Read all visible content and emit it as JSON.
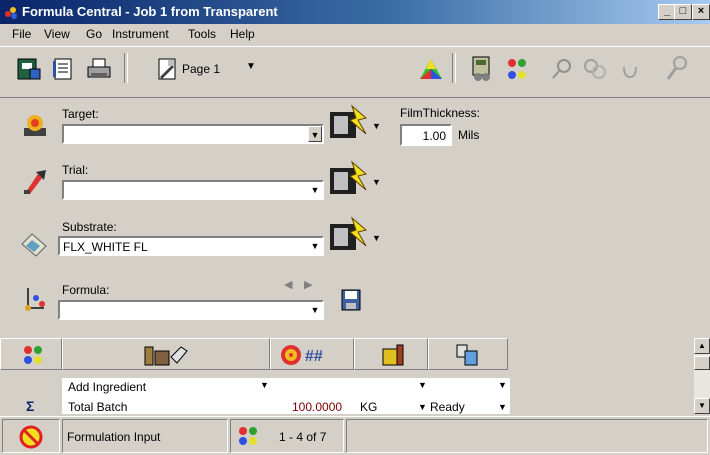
{
  "window": {
    "title": "Formula Central - Job 1 from Transparent",
    "controls": [
      "_",
      "□",
      "×"
    ]
  },
  "menu": [
    "File",
    "View",
    "Go",
    "Instrument",
    "Tools",
    "Help"
  ],
  "toolbar": {
    "page_label": "Page 1"
  },
  "form": {
    "target": {
      "label": "Target:",
      "value": ""
    },
    "trial": {
      "label": "Trial:",
      "value": ""
    },
    "substrate": {
      "label": "Substrate:",
      "value": "FLX_WHITE FL"
    },
    "formula": {
      "label": "Formula:",
      "value": ""
    },
    "film_thickness": {
      "label": "FilmThickness:",
      "value": "1.00",
      "unit": "Mils"
    }
  },
  "grid": {
    "rows": [
      {
        "ingredient": "Add Ingredient",
        "amount": "",
        "unit": "",
        "status": ""
      },
      {
        "ingredient": "Total Batch",
        "amount": "100.0000",
        "unit": "KG",
        "status": "Ready"
      }
    ],
    "sum_symbol": "Σ"
  },
  "status": {
    "message": "Formulation Input",
    "count": "1 - 4 of 7"
  },
  "colors": {
    "title_start": "#0a246a",
    "title_end": "#a6caf0",
    "amount": "#800000",
    "face": "#d4d0c8"
  }
}
